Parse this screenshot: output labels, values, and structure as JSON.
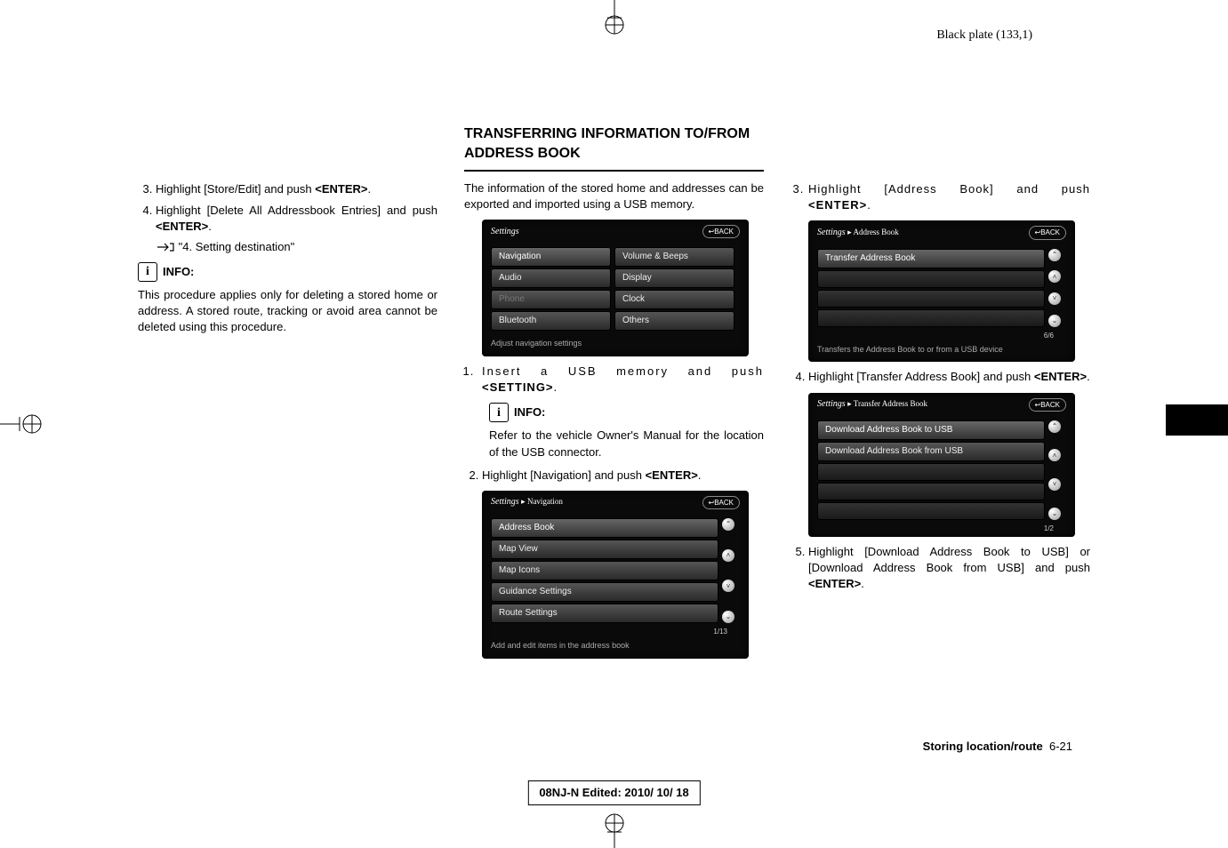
{
  "header": {
    "plate": "Black plate (133,1)"
  },
  "col1": {
    "step3": "Highlight [Store/Edit] and push ",
    "step3b": "<ENTER>",
    "step3c": ".",
    "step4": "Highlight [Delete All Addressbook Entries] and push ",
    "step4b": "<ENTER>",
    "step4c": ".",
    "ref": "\"4. Setting destination\"",
    "info_label": "INFO:",
    "info_text": "This procedure applies only for deleting a stored home or address. A stored route, tracking or avoid area cannot be deleted using this procedure."
  },
  "col2": {
    "heading": "TRANSFERRING INFORMATION TO/FROM ADDRESS BOOK",
    "intro": "The information of the stored home and addresses can be exported and imported using a USB memory.",
    "shot1": {
      "title": "Settings",
      "back": "↩BACK",
      "left": [
        "Navigation",
        "Audio",
        "Phone",
        "Bluetooth"
      ],
      "right": [
        "Volume & Beeps",
        "Display",
        "Clock",
        "Others"
      ],
      "foot": "Adjust navigation settings"
    },
    "step1a": "Insert a USB memory and push ",
    "step1b": "<SETTING>",
    "step1c": ".",
    "info_label": "INFO:",
    "info_text": "Refer to the vehicle Owner's Manual for the location of the USB connector.",
    "step2a": "Highlight [Navigation] and push ",
    "step2b": "<ENTER>",
    "step2c": ".",
    "shot2": {
      "title": "Settings",
      "crumb": "▸ Navigation",
      "back": "↩BACK",
      "rows": [
        "Address Book",
        "Map View",
        "Map Icons",
        "Guidance Settings",
        "Route Settings"
      ],
      "page": "1/13",
      "foot": "Add and edit items in the address book"
    }
  },
  "col3": {
    "step3a": "Highlight [Address Book] and push ",
    "step3b": "<ENTER>",
    "step3c": ".",
    "shot3": {
      "title": "Settings",
      "crumb": "▸ Address Book",
      "back": "↩BACK",
      "row1": "Transfer Address Book",
      "page": "6/6",
      "foot": "Transfers the Address Book to or from a USB device"
    },
    "step4a": "Highlight [Transfer Address Book] and push ",
    "step4b": "<ENTER>",
    "step4c": ".",
    "shot4": {
      "title": "Settings",
      "crumb": "▸ Transfer Address Book",
      "back": "↩BACK",
      "row1": "Download Address Book to USB",
      "row2": "Download Address Book from USB",
      "page": "1/2"
    },
    "step5a": "Highlight [Download Address Book to USB] or [Download Address Book from USB] and push ",
    "step5b": "<ENTER>",
    "step5c": "."
  },
  "footer": {
    "section_label": "Storing location/route",
    "pagenum": "6-21",
    "edit": "08NJ-N Edited:  2010/ 10/ 18"
  }
}
